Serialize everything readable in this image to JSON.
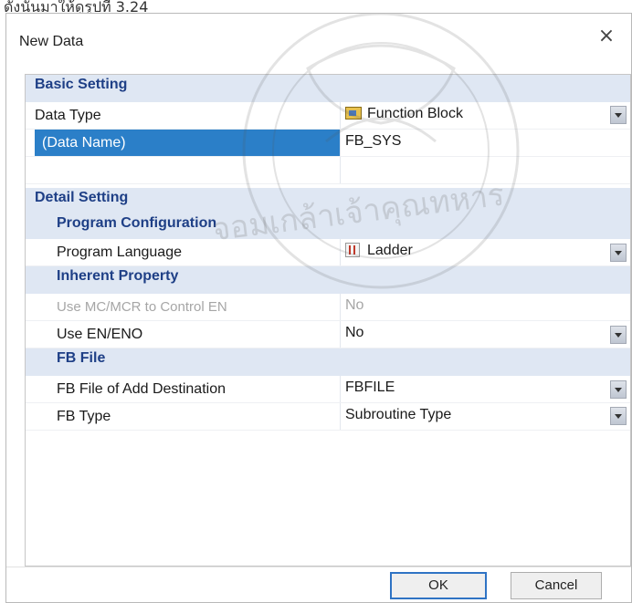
{
  "page_caption": "ดังนั้นมาให้ดูรูปที่ 3.24",
  "dialog": {
    "title": "New Data",
    "close_symbol": "×"
  },
  "sections": {
    "basic": "Basic Setting",
    "detail": "Detail Setting",
    "program_config": "Program Configuration",
    "inherent": "Inherent Property",
    "fb_file": "FB File"
  },
  "properties": {
    "data_type": {
      "name": "Data Type",
      "value": "Function Block",
      "icon": "function-block-icon"
    },
    "data_name": {
      "name": "(Data Name)",
      "value": "FB_SYS"
    },
    "program_language": {
      "name": "Program Language",
      "value": "Ladder",
      "icon": "ladder-icon"
    },
    "use_mc_mcr": {
      "name": "Use MC/MCR to Control EN",
      "value": "No",
      "disabled": true
    },
    "use_en_eno": {
      "name": "Use EN/ENO",
      "value": "No"
    },
    "fb_file_destination": {
      "name": "FB File of Add Destination",
      "value": "FBFILE"
    },
    "fb_type": {
      "name": "FB Type",
      "value": "Subroutine Type"
    }
  },
  "buttons": {
    "ok": "OK",
    "cancel": "Cancel"
  },
  "watermark": {
    "text": "จอมเกล้าเจ้าคุณทหาร"
  },
  "colors": {
    "section_bg": "#dfe7f3",
    "section_text": "#1e3f86",
    "selection": "#2b7fc8",
    "ok_border": "#2f73c4"
  }
}
